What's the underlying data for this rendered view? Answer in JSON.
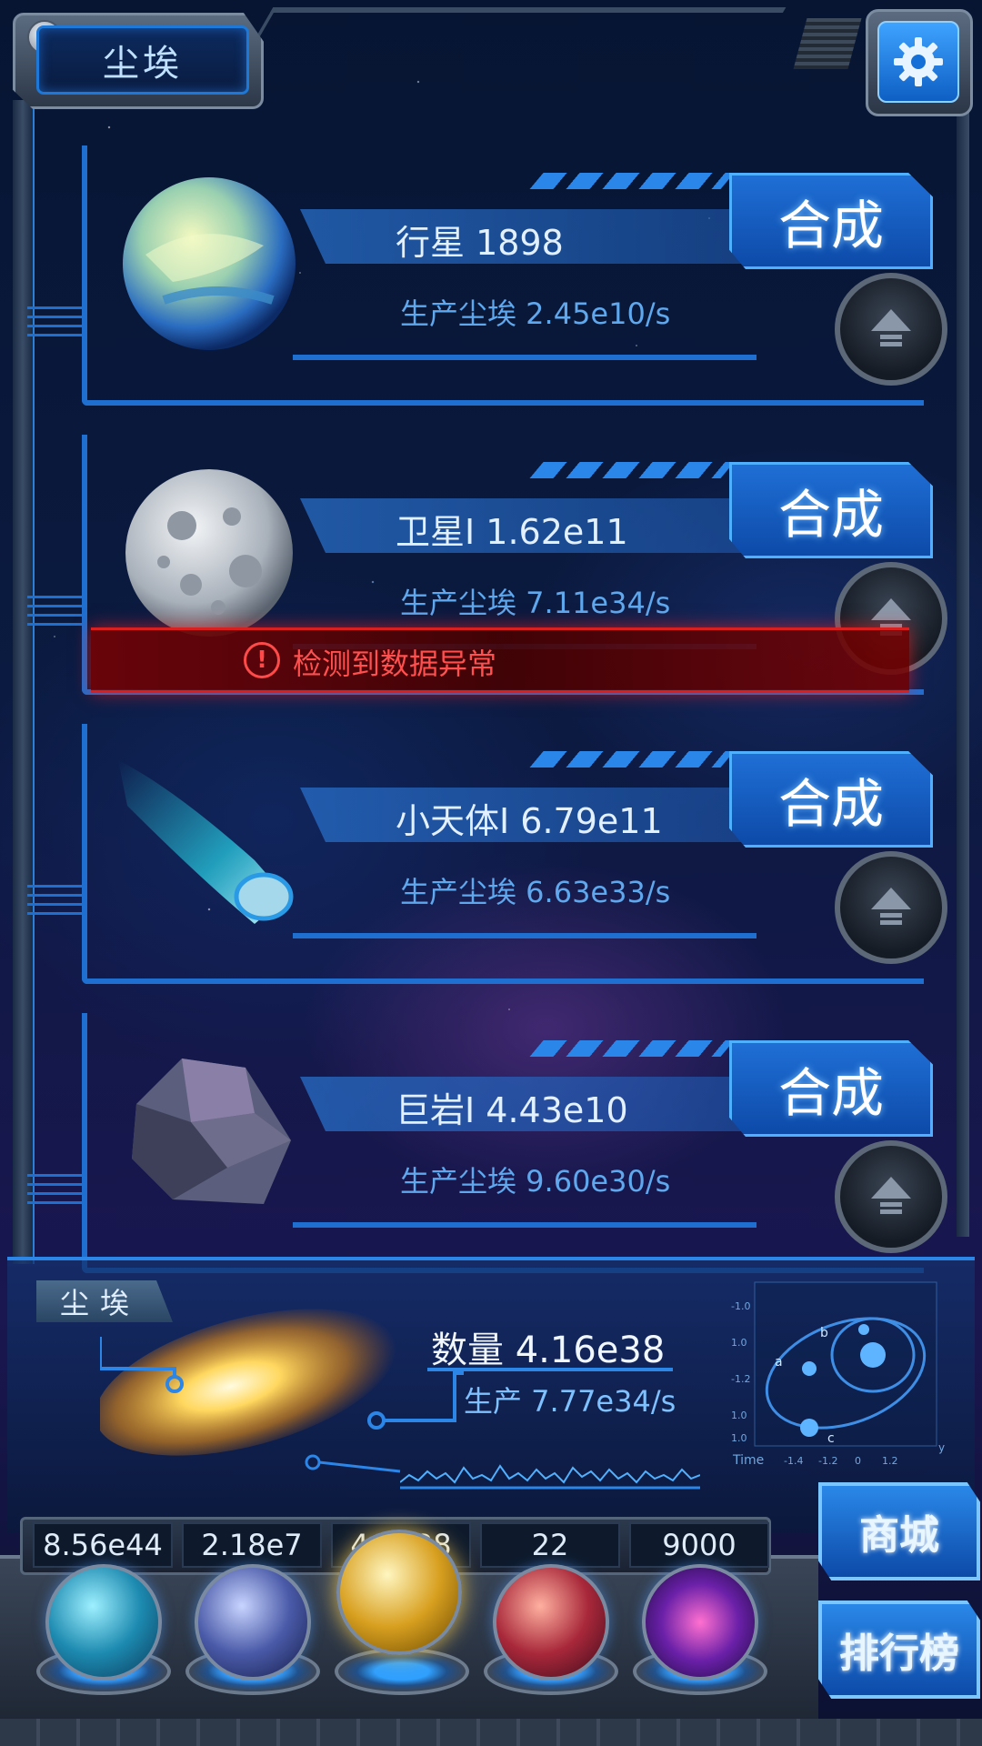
{
  "header": {
    "title": "尘埃",
    "settings_icon": "gear-icon"
  },
  "cards": [
    {
      "name": "行星 1898",
      "production": "生产尘埃  2.45e10/s",
      "combine_label": "合成",
      "art": "planet"
    },
    {
      "name": "卫星I 1.62e11",
      "production": "生产尘埃  7.11e34/s",
      "combine_label": "合成",
      "art": "moon"
    },
    {
      "name": "小天体I 6.79e11",
      "production": "生产尘埃  6.63e33/s",
      "combine_label": "合成",
      "art": "comet"
    },
    {
      "name": "巨岩I 4.43e10",
      "production": "生产尘埃  9.60e30/s",
      "combine_label": "合成",
      "art": "rock"
    }
  ],
  "alert": {
    "text": "检测到数据异常",
    "icon": "exclamation-circle-icon"
  },
  "dust": {
    "tag": "尘埃",
    "count": "数量 4.16e38",
    "rate": "生产 7.77e34/s",
    "graph": {
      "y_ticks": [
        "-1.0",
        "1.0",
        "-1.2",
        "1.0",
        "1.0"
      ],
      "x_label": "Time",
      "x_ticks": [
        "-1.4",
        "-1.2",
        "0",
        "1.2"
      ],
      "points": [
        "a",
        "b",
        "c"
      ],
      "y_axis": "y"
    }
  },
  "counters": [
    "8.56e44",
    "2.18e7",
    "4.8e38",
    "22",
    "9000"
  ],
  "orbs": [
    "atom-orb",
    "lightning-orb",
    "dust-orb",
    "network-orb",
    "vortex-orb"
  ],
  "side_buttons": {
    "shop": "商城",
    "rank": "排行榜"
  },
  "colors": {
    "accent": "#2c86e8",
    "alert": "#d82020",
    "button": "#1f6fd6"
  }
}
